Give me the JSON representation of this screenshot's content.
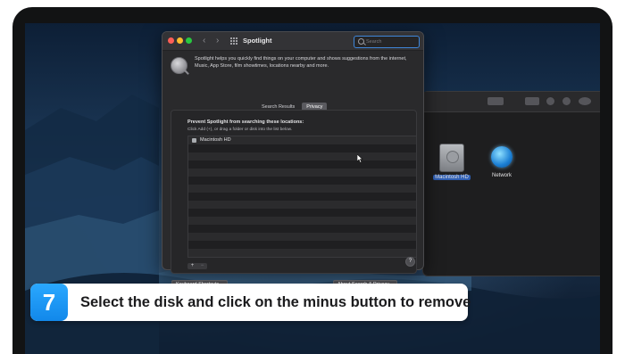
{
  "prefs_window": {
    "title": "Spotlight",
    "search_placeholder": "Search",
    "description": "Spotlight helps you quickly find things on your computer and shows suggestions from the internet, Music, App Store, film showtimes, locations nearby and more.",
    "tabs": [
      {
        "label": "Search Results",
        "active": false
      },
      {
        "label": "Privacy",
        "active": true
      }
    ],
    "privacy": {
      "heading": "Prevent Spotlight from searching these locations:",
      "hint": "Click Add (+), or drag a folder or disk into the list below.",
      "locations": [
        {
          "label": "Macintosh HD",
          "icon": "disk-icon"
        }
      ],
      "add_label": "+",
      "remove_label": "−"
    },
    "keyboard_shortcuts_label": "Keyboard Shortcuts...",
    "about_label": "About Search & Privacy...",
    "help_label": "?"
  },
  "finder": {
    "items": [
      {
        "label": "Macintosh HD",
        "icon": "hard-disk-icon"
      },
      {
        "label": "Network",
        "icon": "network-globe-icon"
      }
    ]
  },
  "banner": {
    "step_number": "7",
    "caption": "Select the disk and click on the minus button to remove"
  },
  "colors": {
    "accent": "#1288ea",
    "focus_ring": "#3f86d9",
    "window_bg": "#2a2a2c"
  }
}
